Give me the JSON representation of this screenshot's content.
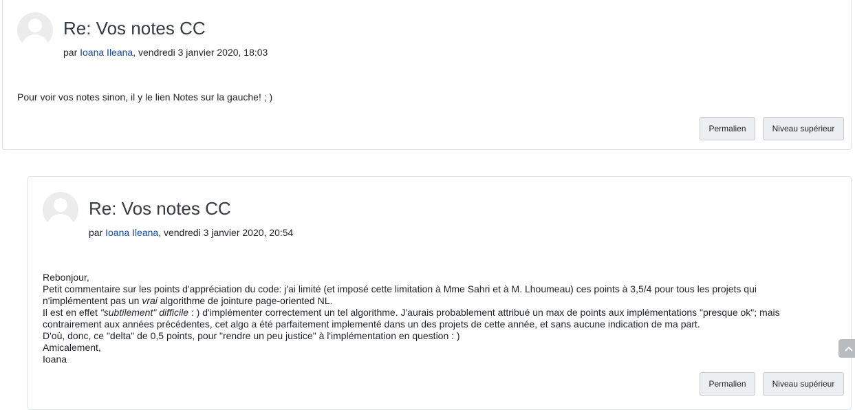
{
  "posts": [
    {
      "title": "Re: Vos notes CC",
      "by_prefix": "par ",
      "author": "Ioana Ileana",
      "date": ", vendredi 3 janvier 2020, 18:03",
      "lines": [
        "Pour voir vos notes sinon, il y le lien Notes sur la gauche! ; )"
      ],
      "permalink_label": "Permalien",
      "parent_label": "Niveau supérieur"
    },
    {
      "title": "Re: Vos notes CC",
      "by_prefix": "par ",
      "author": "Ioana Ileana",
      "date": ", vendredi 3 janvier 2020, 20:54",
      "greeting": "Rebonjour,",
      "line1": "Petit commentaire sur les points d'appréciation du code:  j'ai limité (et imposé cette limitation à Mme Sahri et à M. Lhoumeau) ces points à 3,5/4 pour tous les projets qui",
      "line2_a": "n'implémentent pas un ",
      "line2_em": "vrai",
      "line2_b": " algorithme de jointure page-oriented NL.",
      "line3_a": "Il est en effet ",
      "line3_em": "\"subtilement\" difficile",
      "line3_b": " : ) d'implémenter correctement un tel algorithme. J'aurais probablement attribué un max de points aux implémentations \"presque ok\"; mais",
      "line4": "contrairement aux années précédentes, cet algo a été parfaitement implementé dans un des projets de cette année, et sans aucune indication de ma part.",
      "line5": "D'où, donc, ce \"delta\" de 0,5 points, pour \"rendre un peu justice\" à l'implémentation en question : )",
      "line6": "Amicalement,",
      "line7": "Ioana",
      "permalink_label": "Permalien",
      "parent_label": "Niveau supérieur"
    }
  ],
  "scroll_top_icon": "chevron-up-icon"
}
